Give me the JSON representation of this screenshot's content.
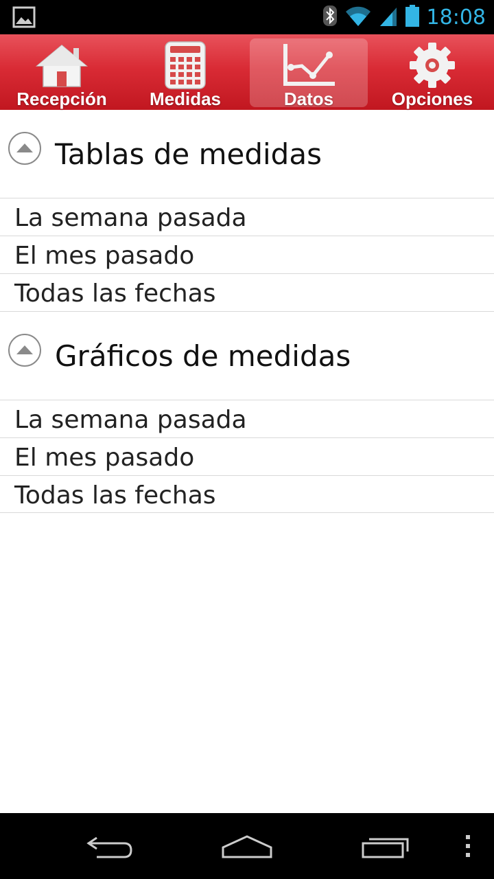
{
  "status_bar": {
    "time": "18:08",
    "icons": [
      "image-notification-icon",
      "bluetooth-icon",
      "wifi-icon",
      "signal-icon",
      "battery-icon"
    ]
  },
  "tabs": [
    {
      "label": "Recepción",
      "icon": "home-icon",
      "active": false
    },
    {
      "label": "Medidas",
      "icon": "calculator-icon",
      "active": false
    },
    {
      "label": "Datos",
      "icon": "line-chart-icon",
      "active": true
    },
    {
      "label": "Opciones",
      "icon": "gear-icon",
      "active": false
    }
  ],
  "groups": [
    {
      "title": "Tablas de medidas",
      "expanded": true,
      "items": [
        "La semana pasada",
        "El mes pasado",
        "Todas las fechas"
      ]
    },
    {
      "title": "Gráficos de medidas",
      "expanded": true,
      "items": [
        "La semana pasada",
        "El mes pasado",
        "Todas las fechas"
      ]
    }
  ],
  "nav_bar": {
    "buttons": [
      "back-icon",
      "home-icon",
      "recent-apps-icon",
      "overflow-menu-icon"
    ]
  },
  "colors": {
    "tab_bar": "#d92b35",
    "status_accent": "#33b5e5"
  }
}
